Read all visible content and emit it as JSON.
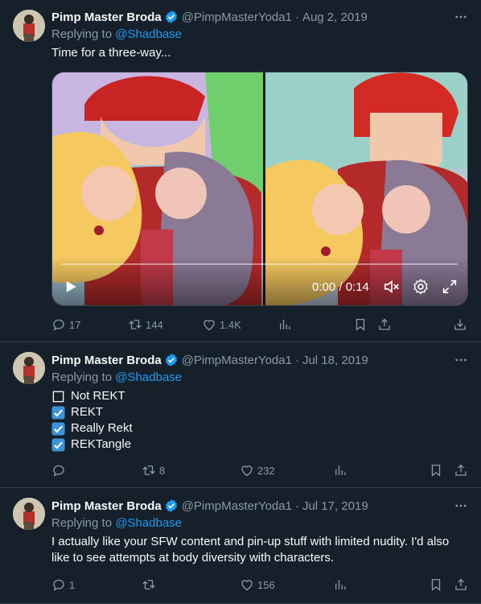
{
  "tweets": [
    {
      "name": "Pimp Master Broda",
      "handle": "@PimpMasterYoda1",
      "separator": "·",
      "date": "Aug 2, 2019",
      "replying_prefix": "Replying to ",
      "replying_to": "@Shadbase",
      "text": "Time for a three-way...",
      "video": {
        "time": "0:00 / 0:14"
      },
      "stats": {
        "replies": "17",
        "retweets": "144",
        "likes": "1.4K"
      }
    },
    {
      "name": "Pimp Master Broda",
      "handle": "@PimpMasterYoda1",
      "separator": "·",
      "date": "Jul 18, 2019",
      "replying_prefix": "Replying to ",
      "replying_to": "@Shadbase",
      "checklist": [
        {
          "label": "Not REKT",
          "checked": false
        },
        {
          "label": "REKT",
          "checked": true
        },
        {
          "label": "Really Rekt",
          "checked": true
        },
        {
          "label": "REKTangle",
          "checked": true
        }
      ],
      "stats": {
        "replies": "",
        "retweets": "8",
        "likes": "232"
      }
    },
    {
      "name": "Pimp Master Broda",
      "handle": "@PimpMasterYoda1",
      "separator": "·",
      "date": "Jul 17, 2019",
      "replying_prefix": "Replying to ",
      "replying_to": "@Shadbase",
      "text": "I actually like your SFW content and pin-up stuff with limited nudity. I'd also like to see attempts at body diversity with characters.",
      "stats": {
        "replies": "1",
        "retweets": "",
        "likes": "156"
      }
    }
  ],
  "colors": {
    "background": "#15202b",
    "accent": "#1d9bf0",
    "muted": "#8b98a5",
    "divider": "#38444d"
  },
  "icons": [
    "verified-badge-icon",
    "more-icon",
    "reply-icon",
    "retweet-icon",
    "like-icon",
    "views-icon",
    "bookmark-icon",
    "share-icon",
    "download-icon",
    "play-icon",
    "mute-icon",
    "settings-icon",
    "fullscreen-icon"
  ]
}
